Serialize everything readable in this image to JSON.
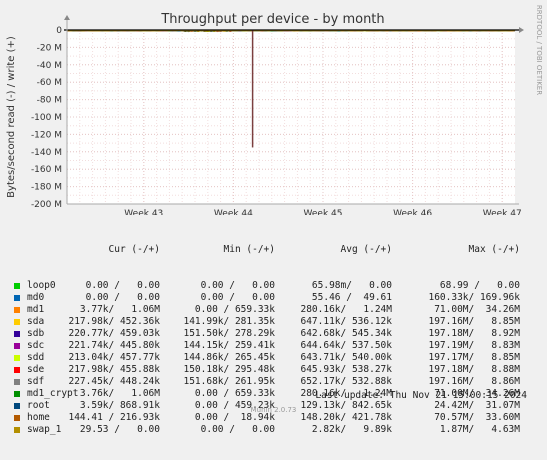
{
  "chart_data": {
    "type": "line",
    "title": "Throughput per device - by month",
    "ylabel": "Bytes/second read (-) / write (+)",
    "side_label": "RRDTOOL / TOBI OETIKER",
    "ylim": [
      -200,
      0
    ],
    "y_ticks": [
      {
        "value": 0,
        "label": "0"
      },
      {
        "value": -20,
        "label": "-20 M"
      },
      {
        "value": -40,
        "label": "-40 M"
      },
      {
        "value": -60,
        "label": "-60 M"
      },
      {
        "value": -80,
        "label": "-80 M"
      },
      {
        "value": -100,
        "label": "-100 M"
      },
      {
        "value": -120,
        "label": "-120 M"
      },
      {
        "value": -140,
        "label": "-140 M"
      },
      {
        "value": -160,
        "label": "-160 M"
      },
      {
        "value": -180,
        "label": "-180 M"
      },
      {
        "value": -200,
        "label": "-200 M"
      }
    ],
    "x_range": [
      0,
      35
    ],
    "x_ticks": [
      {
        "x": 6,
        "label": "Week 43"
      },
      {
        "x": 13,
        "label": "Week 44"
      },
      {
        "x": 20,
        "label": "Week 45"
      },
      {
        "x": 27,
        "label": "Week 46"
      },
      {
        "x": 34,
        "label": "Week 47"
      }
    ],
    "spike": {
      "x": 14.5,
      "y": -135,
      "color": "#7b3f3f"
    },
    "grid": true,
    "legend_headers": {
      "cur": "Cur (-/+)",
      "min": "Min (-/+)",
      "avg": "Avg (-/+)",
      "max": "Max (-/+)"
    },
    "series": [
      {
        "name": "loop0",
        "color": "#00cc00",
        "cur": "0.00 /   0.00",
        "min": "0.00 /   0.00",
        "avg": "65.98m/   0.00",
        "max": "68.99 /   0.00"
      },
      {
        "name": "md0",
        "color": "#0066b3",
        "cur": "0.00 /   0.00",
        "min": "0.00 /   0.00",
        "avg": "55.46 /  49.61",
        "max": "160.33k/ 169.96k"
      },
      {
        "name": "md1",
        "color": "#ff8000",
        "cur": "3.77k/   1.06M",
        "min": "0.00 / 659.33k",
        "avg": "280.16k/   1.24M",
        "max": "71.00M/  34.26M"
      },
      {
        "name": "sda",
        "color": "#ffcc00",
        "cur": "217.98k/ 452.36k",
        "min": "141.99k/ 281.35k",
        "avg": "647.11k/ 536.12k",
        "max": "197.16M/   8.85M"
      },
      {
        "name": "sdb",
        "color": "#330099",
        "cur": "220.77k/ 459.03k",
        "min": "151.50k/ 278.29k",
        "avg": "642.68k/ 545.34k",
        "max": "197.18M/   8.92M"
      },
      {
        "name": "sdc",
        "color": "#990099",
        "cur": "221.74k/ 445.80k",
        "min": "144.15k/ 259.41k",
        "avg": "644.64k/ 537.50k",
        "max": "197.19M/   8.83M"
      },
      {
        "name": "sdd",
        "color": "#ccff00",
        "cur": "213.04k/ 457.77k",
        "min": "144.86k/ 265.45k",
        "avg": "643.71k/ 540.00k",
        "max": "197.17M/   8.85M"
      },
      {
        "name": "sde",
        "color": "#ff0000",
        "cur": "217.98k/ 455.88k",
        "min": "150.18k/ 295.48k",
        "avg": "645.93k/ 538.27k",
        "max": "197.18M/   8.88M"
      },
      {
        "name": "sdf",
        "color": "#808080",
        "cur": "227.45k/ 448.24k",
        "min": "151.68k/ 261.95k",
        "avg": "652.17k/ 532.88k",
        "max": "197.16M/   8.86M"
      },
      {
        "name": "md1_crypt",
        "color": "#008f00",
        "cur": "3.76k/   1.06M",
        "min": "0.00 / 659.33k",
        "avg": "280.16k/   1.24M",
        "max": "71.00M/  34.26M"
      },
      {
        "name": "root",
        "color": "#00487d",
        "cur": "3.59k/ 868.91k",
        "min": "0.00 / 459.23k",
        "avg": "129.13k/ 842.65k",
        "max": "24.42M/  31.07M"
      },
      {
        "name": "home",
        "color": "#b35a00",
        "cur": "144.41 / 216.93k",
        "min": "0.00 /  18.94k",
        "avg": "148.20k/ 421.78k",
        "max": "70.57M/  33.60M"
      },
      {
        "name": "swap_1",
        "color": "#b38f00",
        "cur": "29.53 /   0.00",
        "min": "0.00 /   0.00",
        "avg": "2.82k/   9.89k",
        "max": "1.87M/   4.63M"
      }
    ],
    "last_update": "Last update: Thu Nov 21 15:00:15 2024",
    "footer": "Munin 2.0.73"
  }
}
